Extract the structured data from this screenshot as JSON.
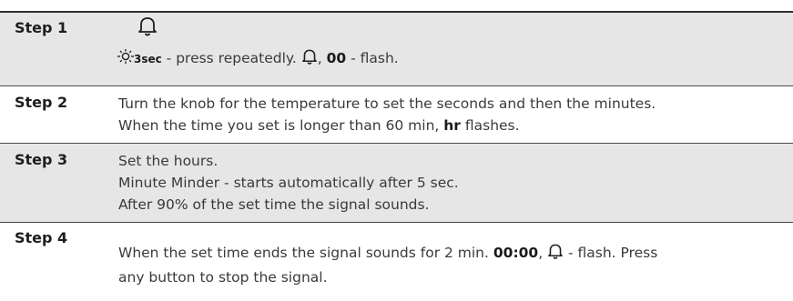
{
  "steps": [
    {
      "label": "Step 1",
      "icon_top": "bell-icon",
      "timer_icon": "light-3sec-icon",
      "timer_text": "3sec",
      "text_a": " - press repeatedly. ",
      "bold_a": "00",
      "text_b": " - flash.",
      "sep_comma": ","
    },
    {
      "label": "Step 2",
      "line1": "Turn the knob for the temperature to set the seconds and then the minutes.",
      "line2_pre": "When the time you set is longer than 60 min, ",
      "line2_bold": "hr",
      "line2_post": " flashes."
    },
    {
      "label": "Step 3",
      "line1": "Set the hours.",
      "line2": "Minute Minder - starts automatically after 5 sec.",
      "line3": "After 90% of the set time the signal sounds."
    },
    {
      "label": "Step 4",
      "line1_pre": "When the set time ends the signal sounds for 2 min. ",
      "line1_bold": "00:00",
      "line1_sep": ", ",
      "line1_post": " - flash. Press",
      "line2": "any button to stop the signal."
    }
  ],
  "colors": {
    "shade": "#e6e6e6",
    "rule": "#4a4a4a",
    "text": "#3a3a3a"
  }
}
